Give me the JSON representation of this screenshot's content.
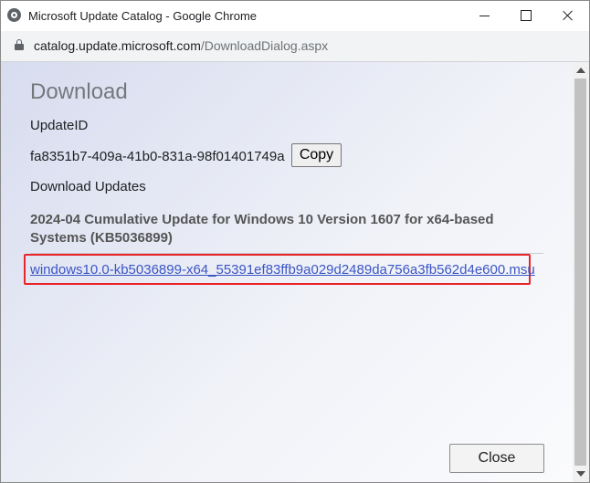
{
  "window": {
    "title": "Microsoft Update Catalog - Google Chrome",
    "url_domain": "catalog.update.microsoft.com",
    "url_path": "/DownloadDialog.aspx"
  },
  "dialog": {
    "heading": "Download",
    "updateid_label": "UpdateID",
    "updateid_value": "fa8351b7-409a-41b0-831a-98f01401749a",
    "copy_label": "Copy",
    "downloads_label": "Download Updates",
    "update_title": "2024-04 Cumulative Update for Windows 10 Version 1607 for x64-based Systems (KB5036899)",
    "file_link": "windows10.0-kb5036899-x64_55391ef83ffb9a029d2489da756a3fb562d4e600.msu",
    "close_label": "Close"
  },
  "colors": {
    "highlight_border": "#e8262a",
    "link": "#3b55c4",
    "heading": "#73787d"
  }
}
